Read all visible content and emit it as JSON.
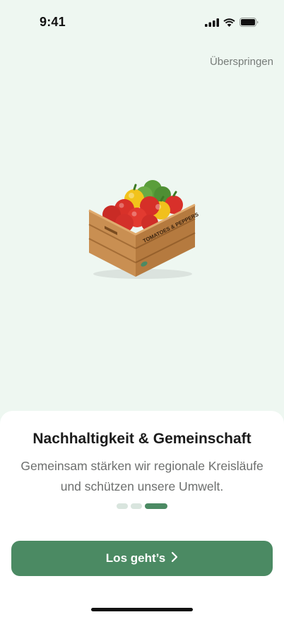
{
  "status_bar": {
    "time": "9:41",
    "icons": [
      "cellular-signal-icon",
      "wifi-icon",
      "battery-icon"
    ]
  },
  "header": {
    "skip_label": "Überspringen"
  },
  "illustration": {
    "icon": "vegetable-crate-illustration",
    "crate_label": "TOMATOES & PEPPERS"
  },
  "onboarding": {
    "title": "Nachhaltigkeit & Gemeinschaft",
    "description": "Gemeinsam stärken wir regionale Kreisläufe und schützen unsere Umwelt.",
    "page_count": 3,
    "current_page": 3,
    "cta_label": "Los geht’s",
    "cta_icon": "chevron-right-icon"
  },
  "colors": {
    "background": "#eef7f1",
    "accent": "#4b8a63",
    "dot_inactive": "#d9e5de",
    "sheet": "#ffffff"
  }
}
